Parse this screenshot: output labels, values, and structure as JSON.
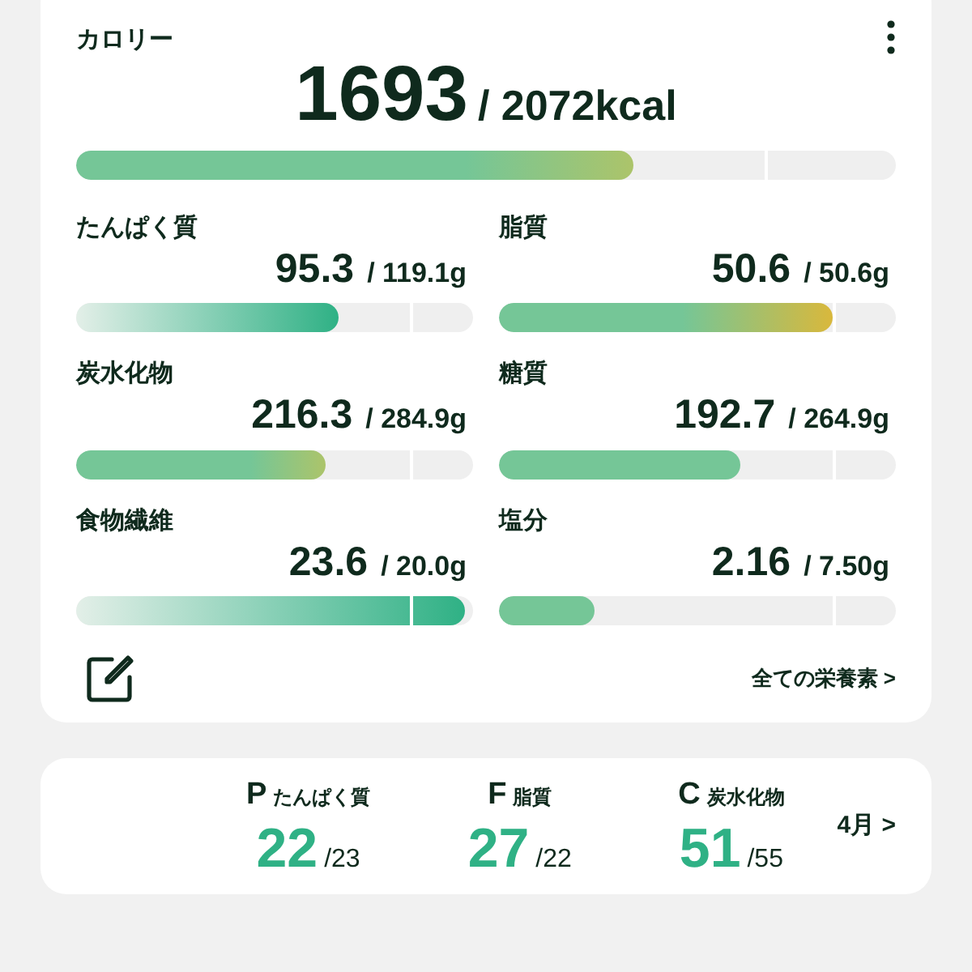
{
  "calorie": {
    "label": "カロリー",
    "value": "1693",
    "target": "/ 2072kcal",
    "level": 0.68,
    "kind": "warm"
  },
  "nutrients": [
    {
      "label": "たんぱく質",
      "value": "95.3",
      "target": "/ 119.1g",
      "level": 0.66,
      "kind": "fade"
    },
    {
      "label": "脂質",
      "value": "50.6",
      "target": "/ 50.6g",
      "level": 0.84,
      "kind": "gold"
    },
    {
      "label": "炭水化物",
      "value": "216.3",
      "target": "/ 284.9g",
      "level": 0.63,
      "kind": "warm"
    },
    {
      "label": "糖質",
      "value": "192.7",
      "target": "/ 264.9g",
      "level": 0.61,
      "kind": "plain"
    },
    {
      "label": "食物繊維",
      "value": "23.6",
      "target": "/ 20.0g",
      "level": 0.98,
      "kind": "fade"
    },
    {
      "label": "塩分",
      "value": "2.16",
      "target": "/ 7.50g",
      "level": 0.24,
      "kind": "plain"
    }
  ],
  "all_nutrients_link": "全ての栄養素 >",
  "pfc": [
    {
      "letter": "P",
      "label": "たんぱく質",
      "value": "22",
      "target": "/23"
    },
    {
      "letter": "F",
      "label": "脂質",
      "value": "27",
      "target": "/22"
    },
    {
      "letter": "C",
      "label": "炭水化物",
      "value": "51",
      "target": "/55"
    }
  ],
  "month_link": "4月 >"
}
